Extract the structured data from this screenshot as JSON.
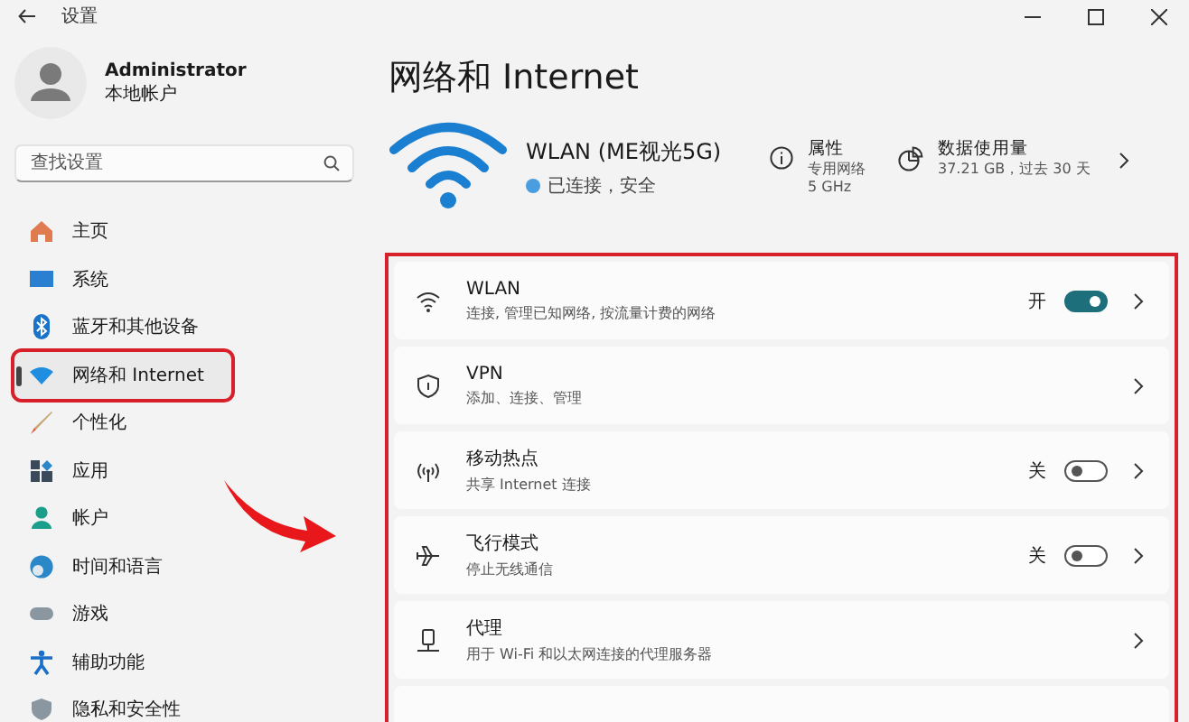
{
  "window": {
    "title": "设置"
  },
  "user": {
    "name": "Administrator",
    "account": "本地帐户"
  },
  "search": {
    "placeholder": "查找设置"
  },
  "sidebar": {
    "items": [
      {
        "label": "主页",
        "selected": false
      },
      {
        "label": "系统",
        "selected": false
      },
      {
        "label": "蓝牙和其他设备",
        "selected": false
      },
      {
        "label": "网络和 Internet",
        "selected": true
      },
      {
        "label": "个性化",
        "selected": false
      },
      {
        "label": "应用",
        "selected": false
      },
      {
        "label": "帐户",
        "selected": false
      },
      {
        "label": "时间和语言",
        "selected": false
      },
      {
        "label": "游戏",
        "selected": false
      },
      {
        "label": "辅助功能",
        "selected": false
      },
      {
        "label": "隐私和安全性",
        "selected": false
      }
    ]
  },
  "page": {
    "title": "网络和 Internet"
  },
  "connection": {
    "name": "WLAN (ME视光5G)",
    "status": "已连接，安全",
    "properties": {
      "title": "属性",
      "lines": [
        "专用网络",
        "5 GHz"
      ]
    },
    "data_usage": {
      "title": "数据使用量",
      "detail": "37.21 GB，过去 30 天"
    }
  },
  "settings": [
    {
      "kind": "toggle",
      "title": "WLAN",
      "subtitle": "连接, 管理已知网络, 按流量计费的网络",
      "state_label": "开",
      "on": true
    },
    {
      "kind": "link",
      "title": "VPN",
      "subtitle": "添加、连接、管理"
    },
    {
      "kind": "toggle",
      "title": "移动热点",
      "subtitle": "共享 Internet 连接",
      "state_label": "关",
      "on": false
    },
    {
      "kind": "toggle",
      "title": "飞行模式",
      "subtitle": "停止无线通信",
      "state_label": "关",
      "on": false
    },
    {
      "kind": "link",
      "title": "代理",
      "subtitle": "用于 Wi-Fi 和以太网连接的代理服务器"
    },
    {
      "kind": "empty"
    }
  ]
}
